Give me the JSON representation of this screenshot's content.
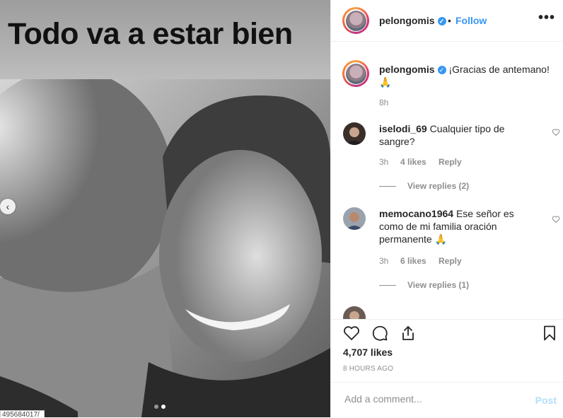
{
  "photo": {
    "caption_overlay": "Todo va a estar bien",
    "url_stub": "495684017/",
    "carousel_dots": 2,
    "active_dot": 2
  },
  "header": {
    "username": "pelongomis",
    "separator": "•",
    "follow_label": "Follow",
    "more_label": "•••"
  },
  "caption": {
    "username": "pelongomis",
    "text": "¡Gracias de antemano! 🙏",
    "time": "8h"
  },
  "comments": [
    {
      "username": "iselodi_69",
      "text": "Cualquier tipo de sangre?",
      "time": "3h",
      "likes": "4 likes",
      "reply_label": "Reply",
      "view_replies": "View replies (2)"
    },
    {
      "username": "memocano1964",
      "text": "Ese señor es como de mi familia oración permanente 🙏",
      "time": "3h",
      "likes": "6 likes",
      "reply_label": "Reply",
      "view_replies": "View replies (1)"
    }
  ],
  "actions": {
    "icons": [
      "heart-icon",
      "comment-icon",
      "share-icon",
      "bookmark-icon"
    ],
    "likes": "4,707 likes",
    "time_ago": "8 HOURS AGO"
  },
  "add_comment": {
    "placeholder": "Add a comment...",
    "post_label": "Post"
  },
  "colors": {
    "accent": "#3897f0",
    "muted": "#8e8e8e",
    "text": "#262626",
    "post_disabled": "#b2dffc"
  }
}
